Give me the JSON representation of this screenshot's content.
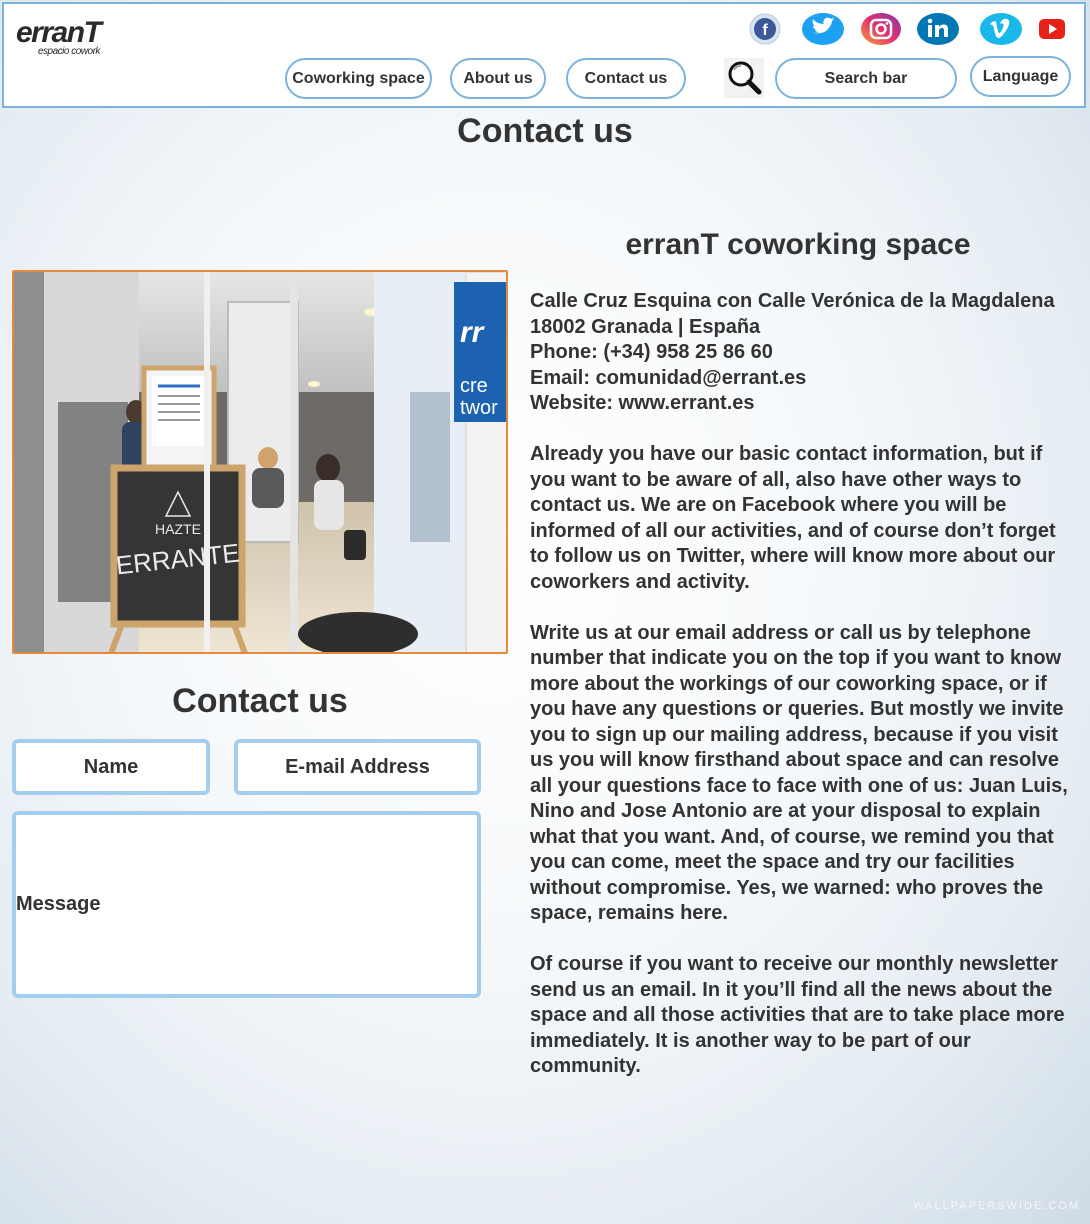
{
  "header": {
    "logo_text": "erranT",
    "logo_subtitle": "espacio cowork",
    "social_icons": [
      {
        "name": "facebook-icon",
        "color": "#3b5998"
      },
      {
        "name": "twitter-icon",
        "color": "#1da1f2"
      },
      {
        "name": "instagram-icon",
        "color": "#c13584"
      },
      {
        "name": "linkedin-icon",
        "color": "#0077b5"
      },
      {
        "name": "vimeo-icon",
        "color": "#1ab7ea"
      },
      {
        "name": "youtube-icon",
        "color": "#e62117"
      }
    ],
    "nav": {
      "coworking_label": "Coworking space",
      "about_label": "About us",
      "contact_label": "Contact us",
      "search_label": "Search bar",
      "language_label": "Language"
    }
  },
  "page": {
    "title": "Contact us"
  },
  "form": {
    "title": "Contact us",
    "name_label": "Name",
    "email_label": "E-mail Address",
    "message_label": "Message"
  },
  "info": {
    "title": "erranT coworking space",
    "address_line1": "Calle Cruz Esquina con Calle Verónica de la Magdalena",
    "address_line2": "18002 Granada | España",
    "phone": "Phone: (+34) 958 25 86 60",
    "email": "Email: comunidad@errant.es",
    "website": "Website: www.errant.es",
    "paragraph1": "Already you have our basic contact information, but if you want to be aware of all, also have other ways to contact us. We are on Facebook where you will be informed of all our activities, and of course don’t forget to follow us on Twitter, where will know more about our coworkers and activity.",
    "paragraph2": "Write us at our email address or call us by telephone number that indicate you on the top if you want to know more about the workings of our coworking space, or if you have any questions or queries. But mostly we invite you to sign up our mailing address, because if you visit us you will know firsthand about space and can resolve all your questions face to face with one of us: Juan Luis, Nino and Jose Antonio are at your disposal to explain what that you want. And, of course, we remind you that you can come, meet the space and try our facilities without compromise. Yes, we warned: who proves the space, remains here.",
    "paragraph3": "Of course if you want to receive our monthly newsletter send us an email. In it you’ll find all the news about the space and all those activities that are to take place more immediately. It is another way to be part of our community."
  },
  "photo": {
    "sign_line1": "HAZTE",
    "sign_line2": "ERRANTE"
  },
  "watermark": "WALLPAPERSWIDE.COM"
}
